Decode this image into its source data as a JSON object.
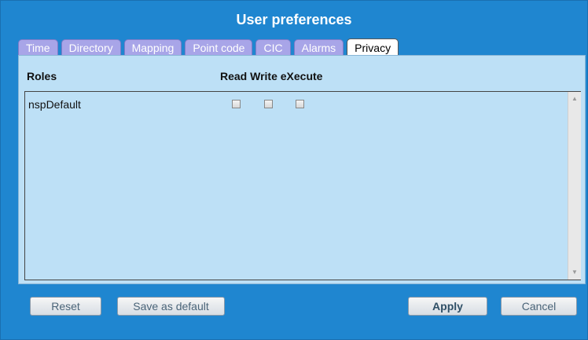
{
  "dialog": {
    "title": "User preferences"
  },
  "tabs": [
    "Time",
    "Directory",
    "Mapping",
    "Point code",
    "CIC",
    "Alarms",
    "Privacy"
  ],
  "active_tab": "Privacy",
  "headers": {
    "roles": "Roles",
    "permissions": "Read Write eXecute"
  },
  "rows": [
    {
      "role": "nspDefault",
      "read": false,
      "write": false,
      "execute": false
    }
  ],
  "buttons": {
    "reset": "Reset",
    "save_default": "Save as default",
    "apply": "Apply",
    "cancel": "Cancel"
  },
  "icons": {
    "scroll_up": "arrow-up-icon",
    "scroll_down": "arrow-down-icon"
  },
  "colors": {
    "background": "#1f86d0",
    "panel": "#bde0f6",
    "tab": "#a8a5e8"
  }
}
